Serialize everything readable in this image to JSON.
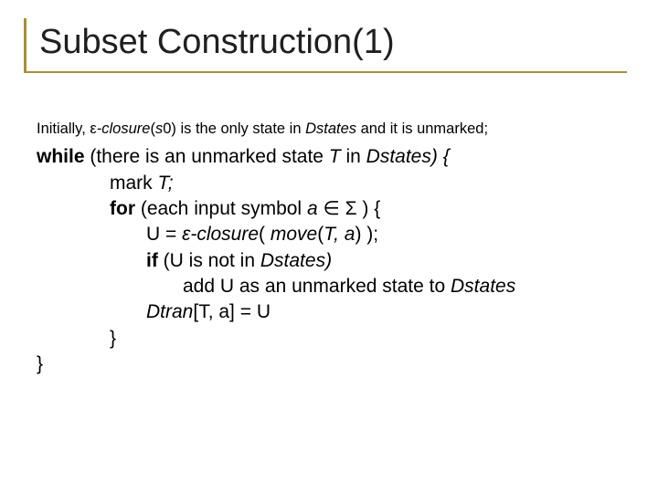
{
  "title": "Subset Construction(1)",
  "intro": {
    "t1": "Initially, ",
    "eps": "ε",
    "t2": "-closure",
    "t3": "(",
    "s0": "s",
    "zero": "0) is the only state in ",
    "dstates": "Dstates",
    "t4": " and it is unmarked;"
  },
  "l1": {
    "while": "while",
    "rest1": " (there is an unmarked state ",
    "T": "T",
    "rest2": " in ",
    "D": "Dstates) {"
  },
  "l2": {
    "t1": "mark ",
    "T": "T;"
  },
  "l3": {
    "for": "for",
    "t1": " (each input symbol ",
    "a": "a",
    "mem": " ∈ Σ ) {"
  },
  "l4": {
    "t1": "U = ",
    "eps": "ε",
    "t2": "-closure",
    "t3": "( ",
    "mv": "move",
    "t4": "(",
    "Ta": "T, a",
    "t5": ") );"
  },
  "l5": {
    "if": "if",
    "t1": " (U is not in ",
    "D": "Dstates)"
  },
  "l6": {
    "t1": "add U as an unmarked state to ",
    "D": "Dstates"
  },
  "l7": {
    "t1": "Dtran",
    "t2": "[T, a]",
    "t3": " = U"
  },
  "l8": {
    "b": "}"
  },
  "l9": {
    "b": "}"
  }
}
